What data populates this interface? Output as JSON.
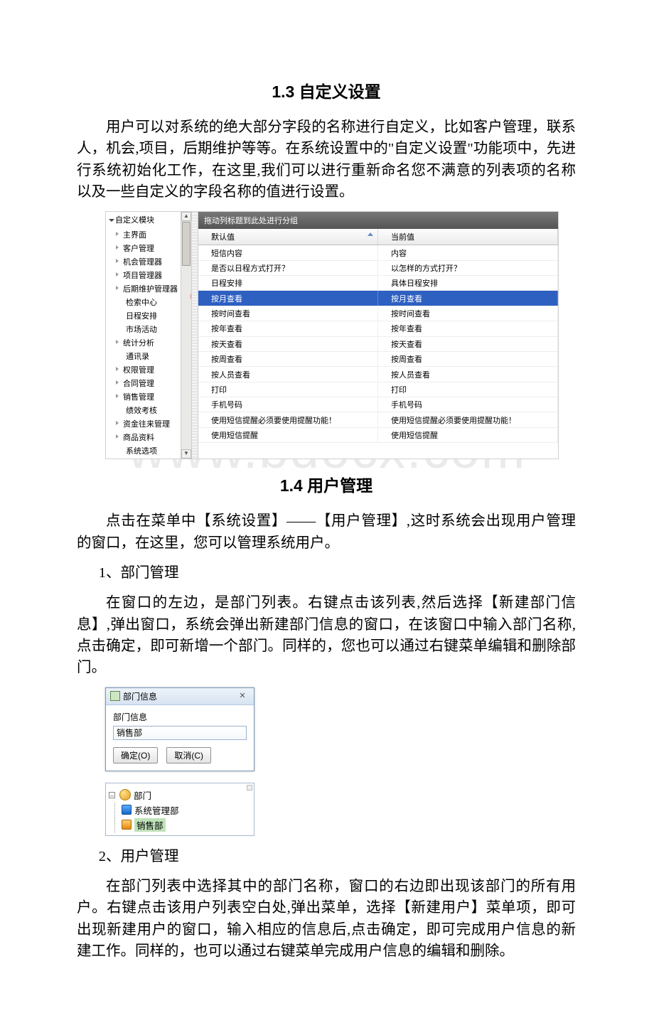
{
  "watermark": "www.bdocx.com",
  "section1": {
    "heading": "1.3 自定义设置",
    "para": "用户可以对系统的绝大部分字段的名称进行自定义，比如客户管理，联系人，机会,项目，后期维护等等。在系统设置中的\"自定义设置\"功能项中，先进行系统初始化工作，在这里,我们可以进行重新命名您不满意的列表项的名称以及一些自定义的字段名称的值进行设置。"
  },
  "fig1": {
    "tree_title": "自定义模块",
    "tree_items": [
      {
        "label": "主界面",
        "expandable": true
      },
      {
        "label": "客户管理",
        "expandable": true
      },
      {
        "label": "机会管理器",
        "expandable": true
      },
      {
        "label": "项目管理器",
        "expandable": true
      },
      {
        "label": "后期维护管理器",
        "expandable": true
      },
      {
        "label": "检索中心",
        "expandable": false
      },
      {
        "label": "日程安排",
        "expandable": false
      },
      {
        "label": "市场活动",
        "expandable": false
      },
      {
        "label": "统计分析",
        "expandable": true
      },
      {
        "label": "通讯录",
        "expandable": false
      },
      {
        "label": "权限管理",
        "expandable": true
      },
      {
        "label": "合同管理",
        "expandable": true
      },
      {
        "label": "销售管理",
        "expandable": true
      },
      {
        "label": "绩效考核",
        "expandable": false
      },
      {
        "label": "资金往来管理",
        "expandable": true
      },
      {
        "label": "商品资料",
        "expandable": true
      },
      {
        "label": "系统选项",
        "expandable": false
      }
    ],
    "groupbar": "拖动列标题到此处进行分组",
    "col1": "默认值",
    "col2": "当前值",
    "rows": [
      {
        "a": "短信内容",
        "b": "内容",
        "sel": false
      },
      {
        "a": "是否以日程方式打开？",
        "b": "以怎样的方式打开？",
        "sel": false
      },
      {
        "a": "日程安排",
        "b": "具体日程安排",
        "sel": false
      },
      {
        "a": "按月查看",
        "b": "按月查看",
        "sel": true
      },
      {
        "a": "按时间查看",
        "b": "按时间查看",
        "sel": false
      },
      {
        "a": "按年查看",
        "b": "按年查看",
        "sel": false
      },
      {
        "a": "按天查看",
        "b": "按天查看",
        "sel": false
      },
      {
        "a": "按周查看",
        "b": "按周查看",
        "sel": false
      },
      {
        "a": "按人员查看",
        "b": "按人员查看",
        "sel": false
      },
      {
        "a": "打印",
        "b": "打印",
        "sel": false
      },
      {
        "a": "手机号码",
        "b": "手机号码",
        "sel": false
      },
      {
        "a": "使用短信提醒必须要使用提醒功能！",
        "b": "使用短信提醒必须要使用提醒功能！",
        "sel": false
      },
      {
        "a": "使用短信提醒",
        "b": "使用短信提醒",
        "sel": false
      }
    ]
  },
  "section2": {
    "heading": "1.4 用户管理",
    "para1": "点击在菜单中【系统设置】——【用户管理】,这时系统会出现用户管理的窗口，在这里，您可以管理系统用户。",
    "item1": "1、部门管理",
    "para2": "在窗口的左边，是部门列表。右键点击该列表,然后选择【新建部门信息】,弹出窗口，系统会弹出新建部门信息的窗口，在该窗口中输入部门名称,点击确定，即可新增一个部门。同样的，您也可以通过右键菜单编辑和删除部门。"
  },
  "fig2": {
    "title": "部门信息",
    "label": "部门信息",
    "input_value": "销售部",
    "btn_ok": "确定(O)",
    "btn_cancel": "取消(C)",
    "tree_root": "部门",
    "tree_child1": "系统管理部",
    "tree_child2": "销售部"
  },
  "section3": {
    "item2": "2、用户管理",
    "para3": "在部门列表中选择其中的部门名称，窗口的右边即出现该部门的所有用户。右键点击该用户列表空白处,弹出菜单，选择【新建用户】菜单项，即可出现新建用户的窗口，输入相应的信息后,点击确定，即可完成用户信息的新建工作。同样的，也可以通过右键菜单完成用户信息的编辑和删除。"
  }
}
